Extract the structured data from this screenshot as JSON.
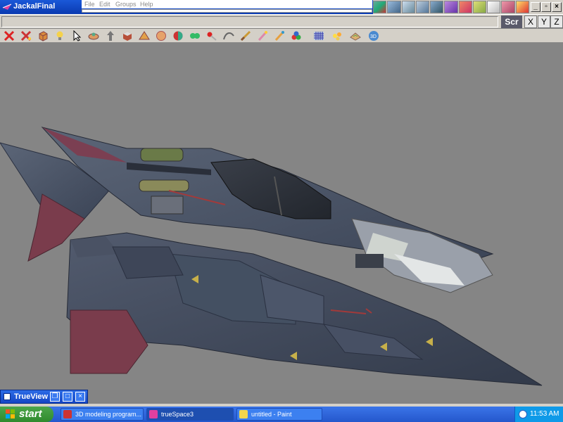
{
  "window": {
    "title": "JackalFinal"
  },
  "menu": [
    "File",
    "Edit",
    "Groups",
    "Help"
  ],
  "view_buttons": {
    "screen": "Scr",
    "axes": [
      "X",
      "Y",
      "Z"
    ]
  },
  "toolbar_icons": [
    "delete-x-icon",
    "cut-x-icon",
    "cube-icon",
    "light-bulb-icon",
    "pointer-icon",
    "object-tool-icon",
    "move-icon",
    "box-icon",
    "pyramid-icon",
    "sphere-icon",
    "color-sphere-icon",
    "blob-icon",
    "paint-icon",
    "spline-icon",
    "knife-icon",
    "brush-icon",
    "material-balls-icon",
    "grid-icon",
    "lights-icon",
    "terrain-icon",
    "3d-icon"
  ],
  "trueview": {
    "title": "TrueView"
  },
  "taskbar": {
    "start": "start",
    "tasks": [
      {
        "label": "3D modeling program...",
        "active": false
      },
      {
        "label": "trueSpace3",
        "active": true
      },
      {
        "label": "untitled - Paint",
        "active": false
      }
    ],
    "clock": "11:53 AM"
  },
  "colors": {
    "viewport": "#858585",
    "hull": "#4b5466",
    "accent_red": "#7a3c4c",
    "titlebar": "#1a58d8",
    "taskbar": "#2457cc"
  }
}
